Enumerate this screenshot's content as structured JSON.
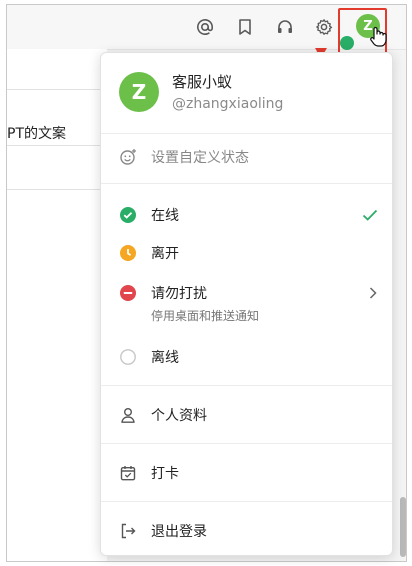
{
  "topbar": {
    "icons": [
      "at-icon",
      "bookmark-icon",
      "headset-icon",
      "gear-icon"
    ],
    "avatar_letter": "Z"
  },
  "background": {
    "snippet": "PT的文案"
  },
  "menu": {
    "profile": {
      "avatar_letter": "Z",
      "name": "客服小蚁",
      "handle": "@zhangxiaoling"
    },
    "custom_status": "设置自定义状态",
    "statuses": [
      {
        "label": "在线",
        "color": "#2aae67",
        "icon": "check-circle-icon",
        "selected": true
      },
      {
        "label": "离开",
        "color": "#f5a623",
        "icon": "clock-circle-icon",
        "selected": false
      },
      {
        "label": "请勿打扰",
        "color": "#e0464b",
        "icon": "minus-circle-icon",
        "selected": false,
        "sub": "停用桌面和推送通知"
      },
      {
        "label": "离线",
        "color": "#c7c7c7",
        "icon": "empty-circle-icon",
        "selected": false
      }
    ],
    "profile_link": "个人资料",
    "checkin": "打卡",
    "logout": "退出登录"
  },
  "colors": {
    "accent_green": "#2aae67",
    "avatar_green": "#6cc04a",
    "highlight_red": "#e23b2e"
  }
}
